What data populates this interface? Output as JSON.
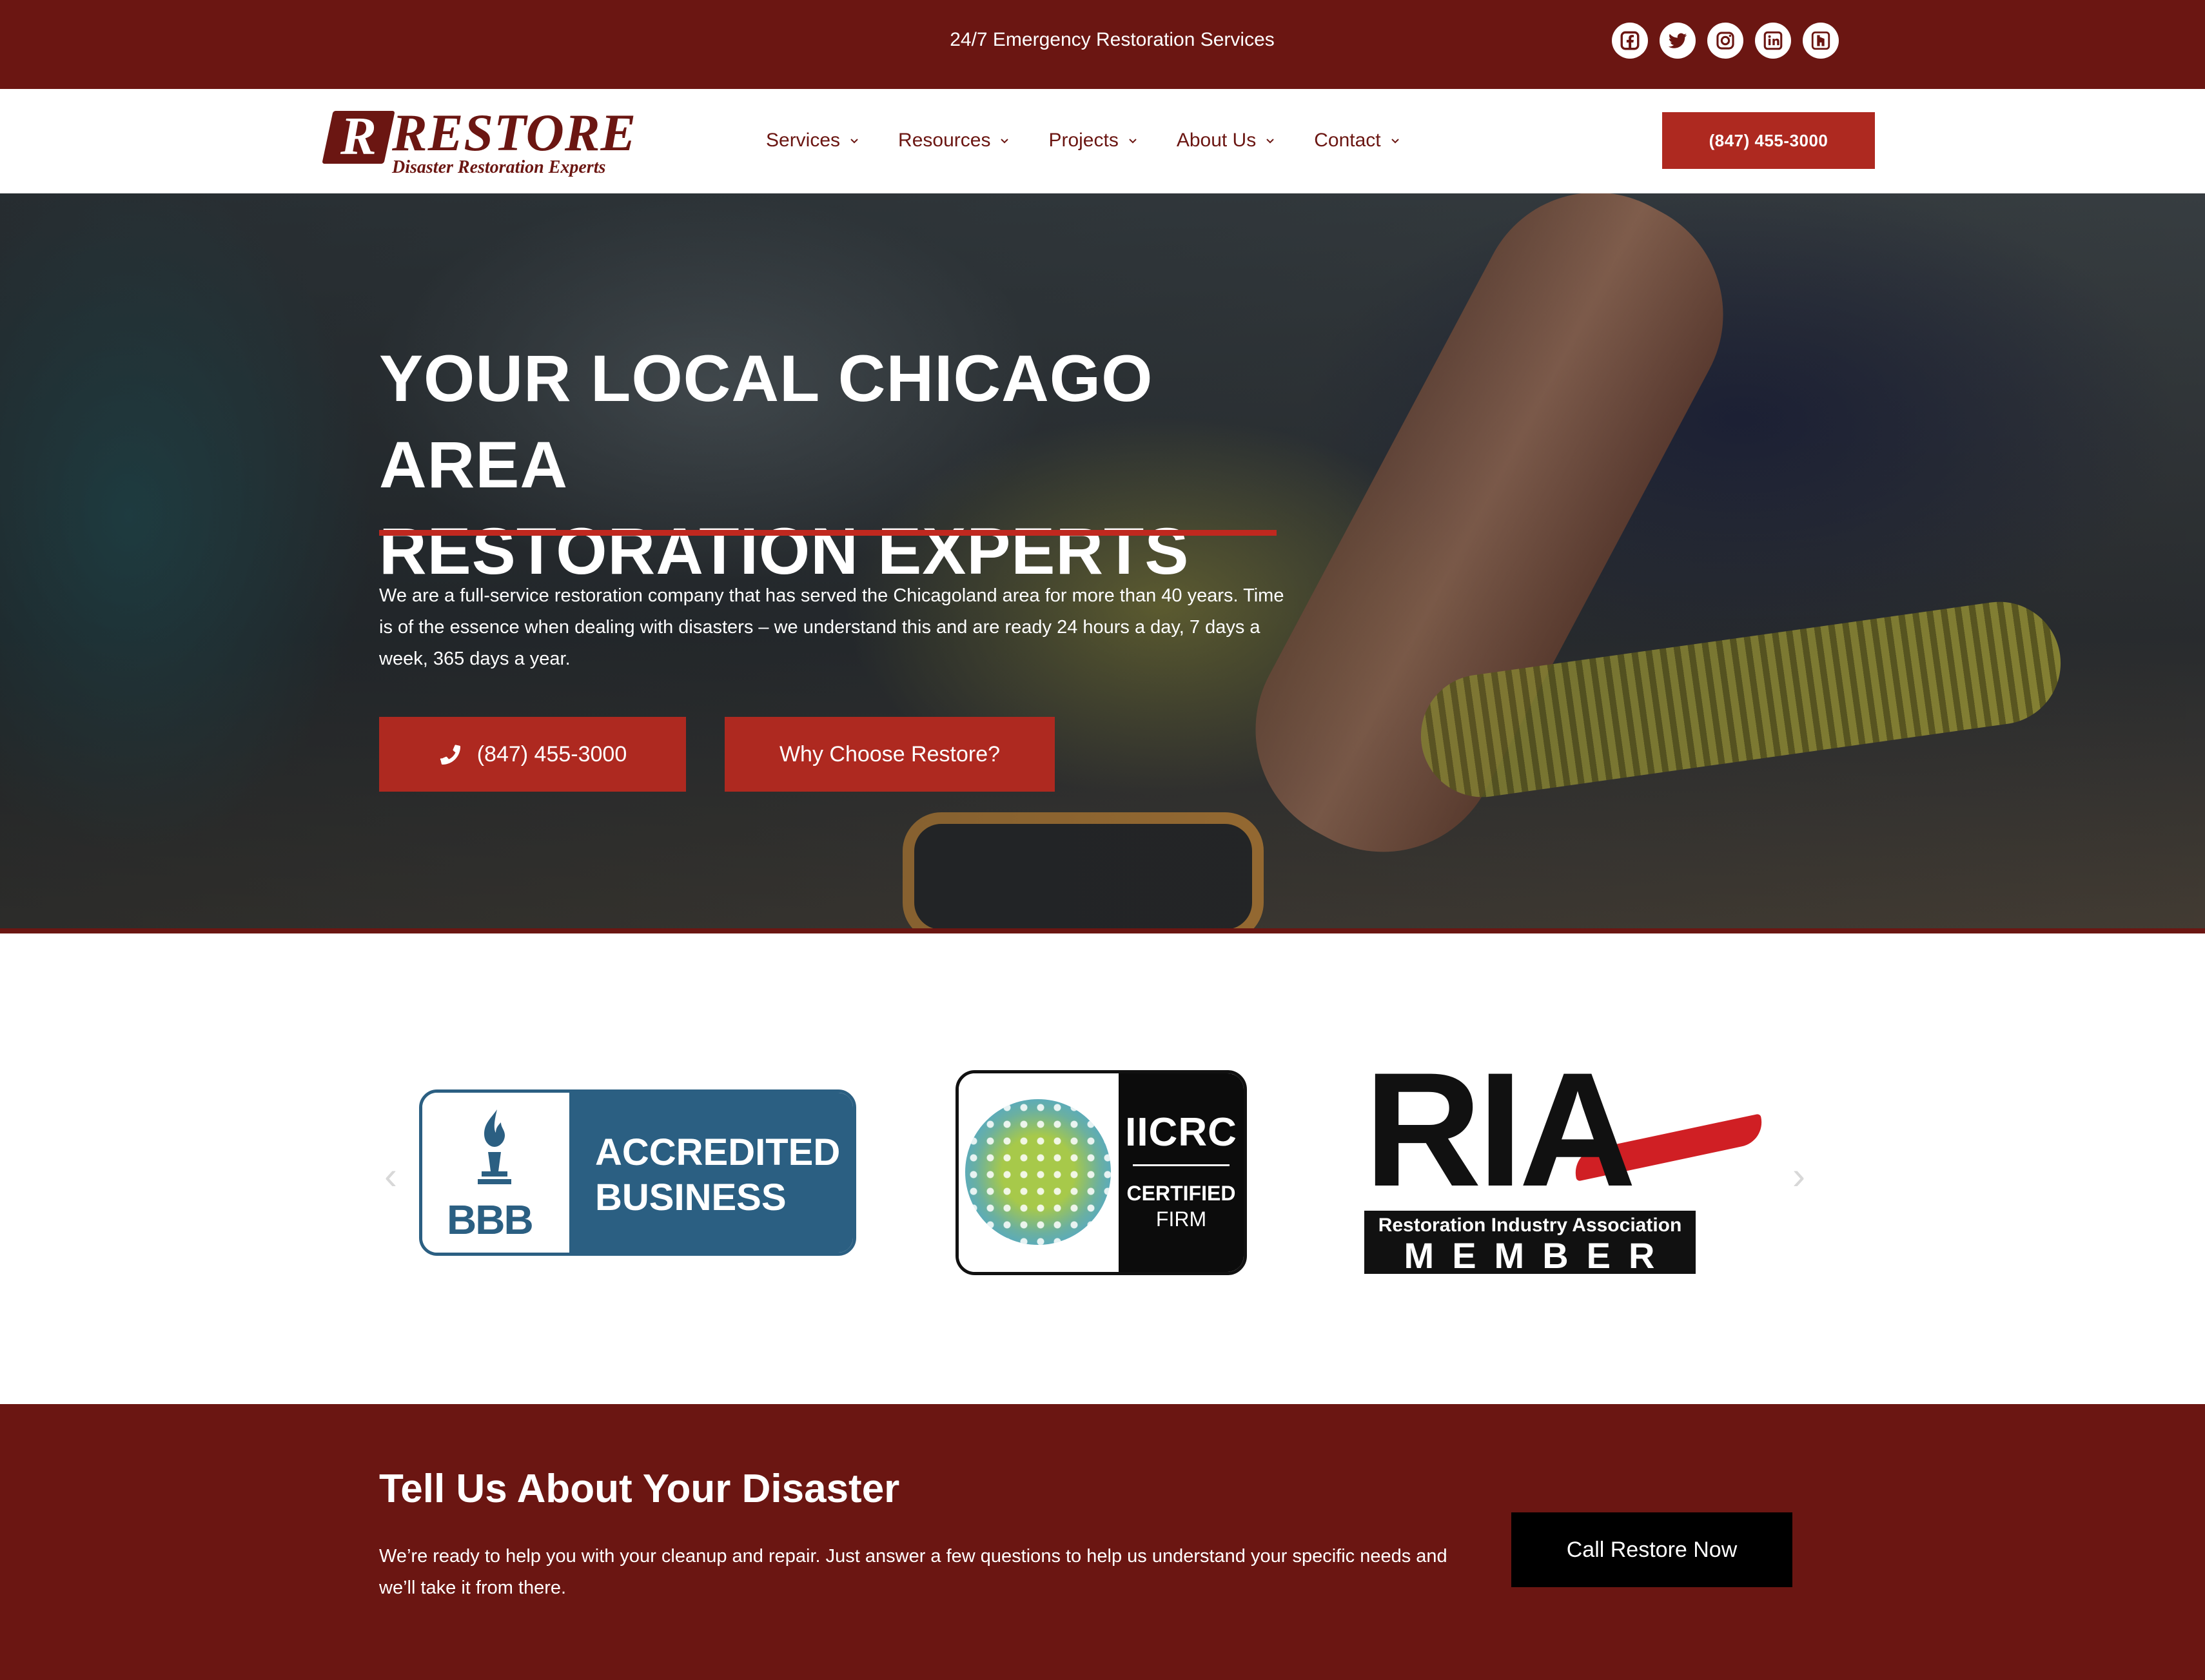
{
  "topbar": {
    "announcement": "24/7 Emergency Restoration Services",
    "socials": [
      {
        "icon": "facebook-icon"
      },
      {
        "icon": "twitter-icon"
      },
      {
        "icon": "instagram-icon"
      },
      {
        "icon": "linkedin-icon"
      },
      {
        "icon": "houzz-icon"
      }
    ]
  },
  "nav": {
    "logo": {
      "mark": "R",
      "word": "RESTORE",
      "tagline": "Disaster Restoration Experts"
    },
    "menu": [
      {
        "label": "Services"
      },
      {
        "label": "Resources"
      },
      {
        "label": "Projects"
      },
      {
        "label": "About Us"
      },
      {
        "label": "Contact"
      }
    ],
    "phone_button": "(847) 455-3000"
  },
  "hero": {
    "title_line1": "YOUR LOCAL CHICAGO AREA",
    "title_line2": "RESTORATION EXPERTS",
    "body": "We are a full-service restoration company that has served the Chicagoland area for more than 40 years. Time is of the essence when dealing with disasters – we understand this and are ready 24 hours a day, 7 days a week, 365 days a year.",
    "phone_button": "(847) 455-3000",
    "why_button": "Why Choose Restore?"
  },
  "logos": {
    "bbb": {
      "letters": "BBB",
      "line1": "ACCREDITED",
      "line2": "BUSINESS"
    },
    "iicrc": {
      "name": "IICRC",
      "certified": "CERTIFIED",
      "firm": "FIRM"
    },
    "ria": {
      "letters": "RIA",
      "association": "Restoration Industry Association",
      "member": "MEMBER"
    }
  },
  "cta": {
    "title": "Tell Us About Your Disaster",
    "body": "We’re ready to help you with your cleanup and repair. Just answer a few questions to help us understand your specific needs and we’ll take it from there.",
    "button": "Call Restore Now"
  },
  "colors": {
    "brand_dark": "#6b1612",
    "brand_red": "#ae2920",
    "rule_red": "#c0281f",
    "bbb_blue": "#2b5f82"
  }
}
